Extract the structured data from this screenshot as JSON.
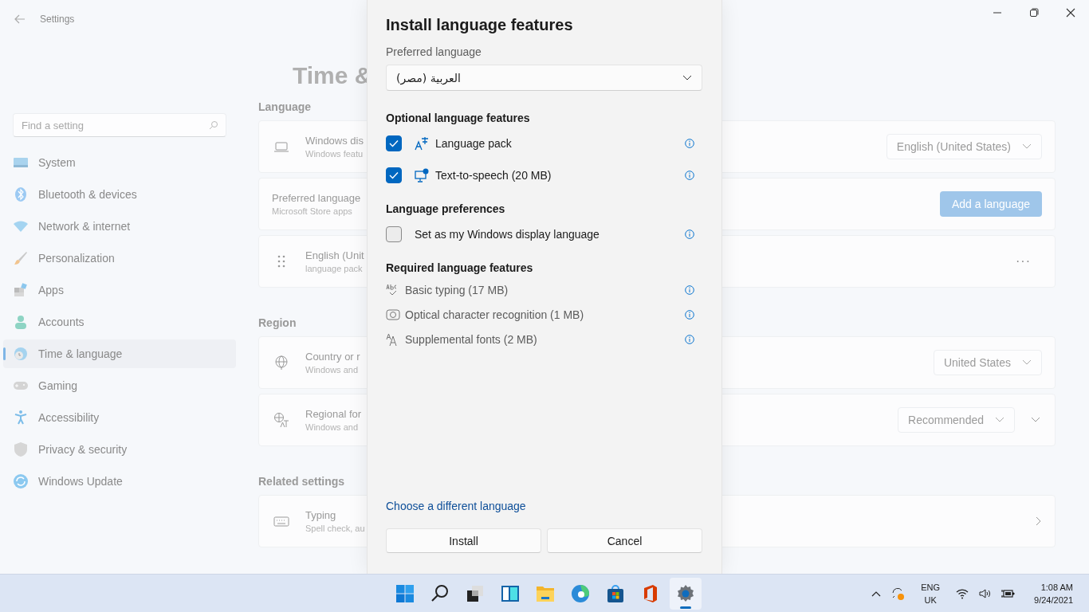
{
  "window": {
    "title": "Settings"
  },
  "search": {
    "placeholder": "Find a setting"
  },
  "sidebar": {
    "items": [
      {
        "label": "System",
        "selected": false
      },
      {
        "label": "Bluetooth & devices",
        "selected": false
      },
      {
        "label": "Network & internet",
        "selected": false
      },
      {
        "label": "Personalization",
        "selected": false
      },
      {
        "label": "Apps",
        "selected": false
      },
      {
        "label": "Accounts",
        "selected": false
      },
      {
        "label": "Time & language",
        "selected": true
      },
      {
        "label": "Gaming",
        "selected": false
      },
      {
        "label": "Accessibility",
        "selected": false
      },
      {
        "label": "Privacy & security",
        "selected": false
      },
      {
        "label": "Windows Update",
        "selected": false
      }
    ]
  },
  "page": {
    "title": "Time &",
    "sections": [
      {
        "heading": "Language",
        "cards": [
          {
            "kind": "dropdown",
            "title": "Windows dis",
            "subtitle": "Windows featu",
            "value": "English (United States)"
          },
          {
            "kind": "button",
            "title": "Preferred language",
            "subtitle": "Microsoft Store apps",
            "value": "Add a language"
          },
          {
            "kind": "more",
            "title": "English (Unit",
            "subtitle": "language pack",
            "value": "···"
          }
        ]
      },
      {
        "heading": "Region",
        "cards": [
          {
            "kind": "dropdown",
            "title": "Country or r",
            "subtitle": "Windows and",
            "value": "United States"
          },
          {
            "kind": "dropdown-expand",
            "title": "Regional for",
            "subtitle": "Windows and",
            "value": "Recommended"
          }
        ]
      },
      {
        "heading": "Related settings",
        "cards": [
          {
            "kind": "link",
            "title": "Typing",
            "subtitle": "Spell check, au"
          }
        ]
      }
    ]
  },
  "dialog": {
    "title": "Install language features",
    "select_label": "Preferred language",
    "select": {
      "value": "العربية (مصر)"
    },
    "sections": [
      {
        "heading": "Optional language features",
        "items": [
          {
            "kind": "icon-checkbox",
            "label": "Language pack",
            "checked": true
          },
          {
            "kind": "icon-checkbox",
            "label": "Text-to-speech (20 MB)",
            "checked": true
          }
        ]
      },
      {
        "heading": "Language preferences",
        "items": [
          {
            "kind": "checkbox",
            "label": "Set as my Windows display language",
            "checked": false
          }
        ]
      },
      {
        "heading": "Required language features",
        "items": [
          {
            "kind": "feature",
            "label": "Basic typing (17 MB)"
          },
          {
            "kind": "feature",
            "label": "Optical character recognition (1 MB)"
          },
          {
            "kind": "feature",
            "label": "Supplemental fonts (2 MB)"
          }
        ]
      }
    ],
    "link": "Choose a different language",
    "buttons": [
      "Install",
      "Cancel"
    ]
  },
  "taskbar": {
    "apps": [
      {
        "selected": false
      },
      {
        "selected": false
      },
      {
        "selected": false
      },
      {
        "selected": false
      },
      {
        "selected": false
      },
      {
        "selected": false
      },
      {
        "selected": false
      },
      {
        "selected": false
      },
      {
        "selected": true
      }
    ],
    "language": {
      "code": "ENG",
      "layout": "UK"
    },
    "time": "1:08 AM",
    "date": "9/24/2021"
  }
}
